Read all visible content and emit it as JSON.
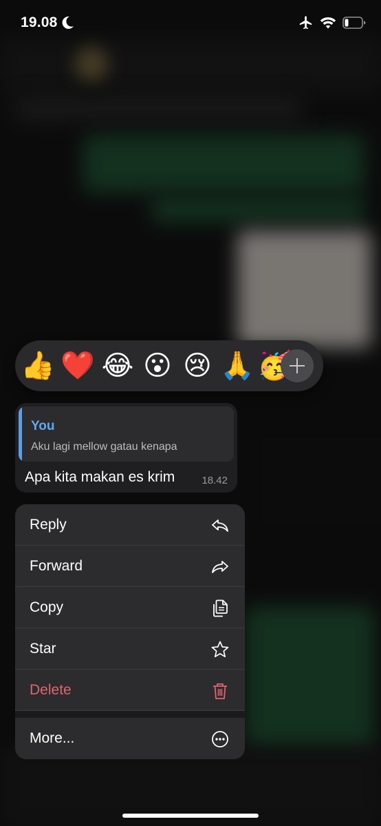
{
  "status_bar": {
    "time": "19.08",
    "icons": [
      "moon-icon",
      "airplane-icon",
      "wifi-icon",
      "battery-icon"
    ]
  },
  "reactions": {
    "emojis": [
      "👍",
      "❤️",
      "😂",
      "😮",
      "😢",
      "🙏",
      "🥳"
    ],
    "add_icon": "plus-icon"
  },
  "message": {
    "quote_author": "You",
    "quote_text": "Aku lagi mellow gatau kenapa",
    "text": "Apa kita makan es krim",
    "time": "18.42"
  },
  "menu": {
    "items": [
      {
        "label": "Reply",
        "icon": "reply-icon"
      },
      {
        "label": "Forward",
        "icon": "forward-icon"
      },
      {
        "label": "Copy",
        "icon": "copy-icon"
      },
      {
        "label": "Star",
        "icon": "star-icon"
      },
      {
        "label": "Delete",
        "icon": "trash-icon"
      },
      {
        "label": "More...",
        "icon": "more-icon"
      }
    ]
  },
  "colors": {
    "accent_blue": "#61a8ee",
    "danger_red": "#e0646f",
    "menu_bg": "#2c2c2e"
  }
}
